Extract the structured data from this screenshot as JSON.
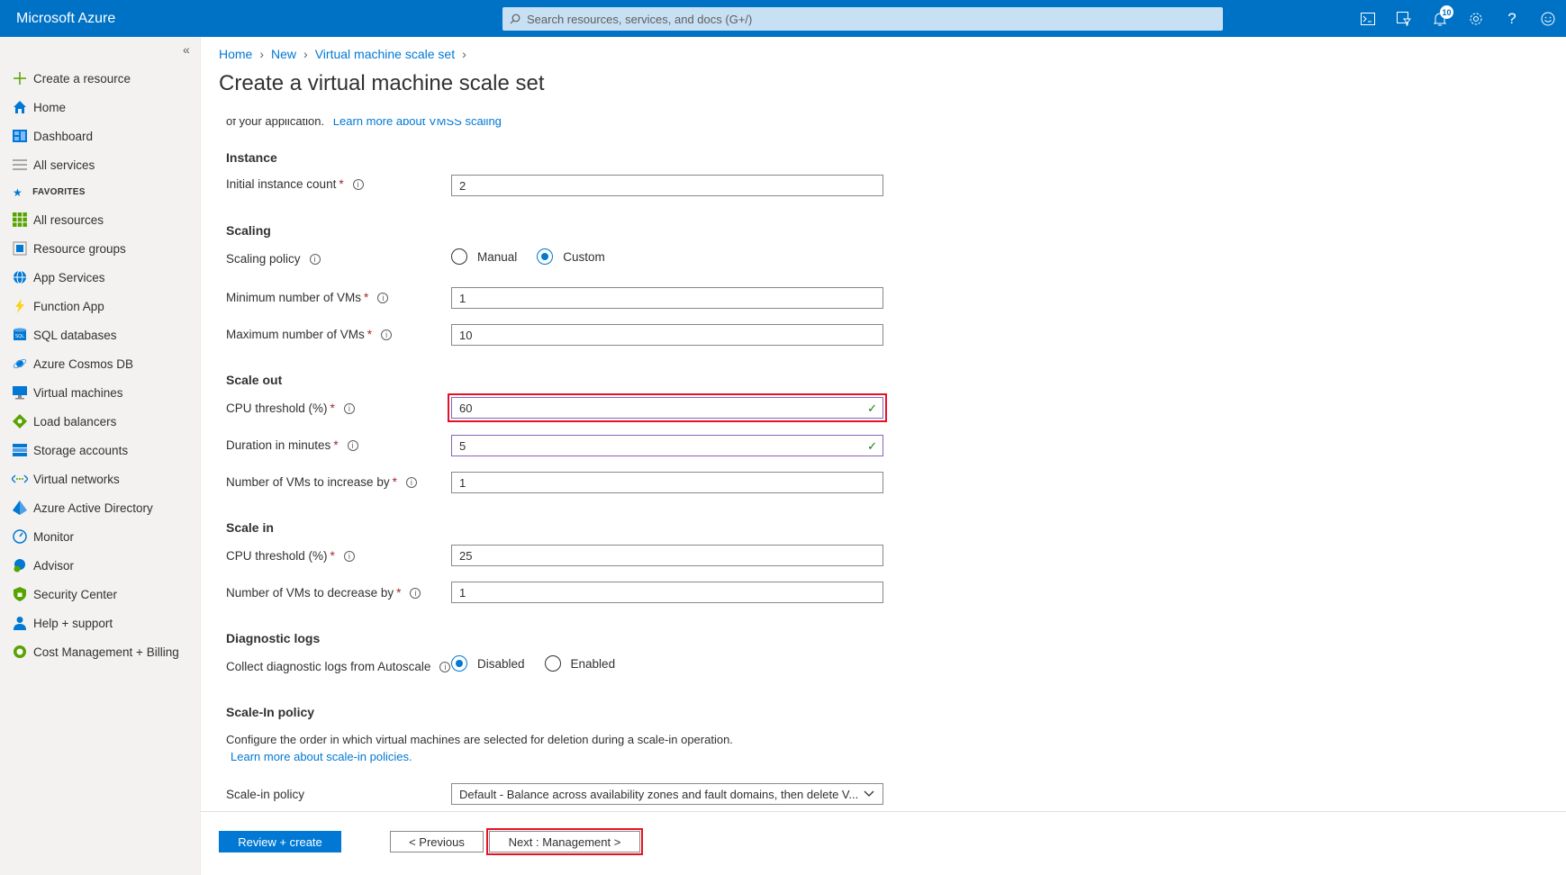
{
  "header": {
    "brand": "Microsoft Azure",
    "search_placeholder": "Search resources, services, and docs (G+/)",
    "notification_count": "10",
    "icons": [
      "cloud-shell-icon",
      "directory-filter-icon",
      "notifications-icon",
      "settings-icon",
      "help-icon",
      "feedback-icon"
    ]
  },
  "sidebar": {
    "collapse": "«",
    "items": [
      {
        "label": "Create a resource",
        "icon": "plus-icon"
      },
      {
        "label": "Home",
        "icon": "home-icon"
      },
      {
        "label": "Dashboard",
        "icon": "dashboard-icon"
      },
      {
        "label": "All services",
        "icon": "list-icon"
      }
    ],
    "favorites_label": "FAVORITES",
    "favorites": [
      {
        "label": "All resources",
        "icon": "grid-icon"
      },
      {
        "label": "Resource groups",
        "icon": "resource-groups-icon"
      },
      {
        "label": "App Services",
        "icon": "globe-icon"
      },
      {
        "label": "Function App",
        "icon": "lightning-icon"
      },
      {
        "label": "SQL databases",
        "icon": "sql-icon"
      },
      {
        "label": "Azure Cosmos DB",
        "icon": "cosmos-icon"
      },
      {
        "label": "Virtual machines",
        "icon": "monitor-icon"
      },
      {
        "label": "Load balancers",
        "icon": "diamond-icon"
      },
      {
        "label": "Storage accounts",
        "icon": "storage-icon"
      },
      {
        "label": "Virtual networks",
        "icon": "network-icon"
      },
      {
        "label": "Azure Active Directory",
        "icon": "aad-icon"
      },
      {
        "label": "Monitor",
        "icon": "gauge-icon"
      },
      {
        "label": "Advisor",
        "icon": "advisor-icon"
      },
      {
        "label": "Security Center",
        "icon": "shield-icon"
      },
      {
        "label": "Help + support",
        "icon": "person-icon"
      },
      {
        "label": "Cost Management + Billing",
        "icon": "cost-icon"
      }
    ]
  },
  "breadcrumb": [
    "Home",
    "New",
    "Virtual machine scale set"
  ],
  "page_title": "Create a virtual machine scale set",
  "intro": {
    "text": "of your application.",
    "link": "Learn more about VMSS scaling"
  },
  "instance": {
    "title": "Instance",
    "initial_count_label": "Initial instance count",
    "initial_count_value": "2"
  },
  "scaling": {
    "title": "Scaling",
    "policy_label": "Scaling policy",
    "policy_options": [
      "Manual",
      "Custom"
    ],
    "policy_selected": "Custom",
    "min_label": "Minimum number of VMs",
    "min_value": "1",
    "max_label": "Maximum number of VMs",
    "max_value": "10"
  },
  "scale_out": {
    "title": "Scale out",
    "cpu_label": "CPU threshold (%)",
    "cpu_value": "60",
    "duration_label": "Duration in minutes",
    "duration_value": "5",
    "increase_label": "Number of VMs to increase by",
    "increase_value": "1"
  },
  "scale_in": {
    "title": "Scale in",
    "cpu_label": "CPU threshold (%)",
    "cpu_value": "25",
    "decrease_label": "Number of VMs to decrease by",
    "decrease_value": "1"
  },
  "diagnostic": {
    "title": "Diagnostic logs",
    "label": "Collect diagnostic logs from Autoscale",
    "options": [
      "Disabled",
      "Enabled"
    ],
    "selected": "Disabled"
  },
  "scale_in_policy": {
    "title": "Scale-In policy",
    "description": "Configure the order in which virtual machines are selected for deletion during a scale-in operation.",
    "link": "Learn more about scale-in policies.",
    "label": "Scale-in policy",
    "value": "Default - Balance across availability zones and fault domains, then delete V..."
  },
  "footer": {
    "review_create": "Review + create",
    "previous": "< Previous",
    "next": "Next : Management >"
  },
  "colors": {
    "accent": "#0078d4",
    "topbar": "#0072c6",
    "highlight": "#e81123"
  }
}
